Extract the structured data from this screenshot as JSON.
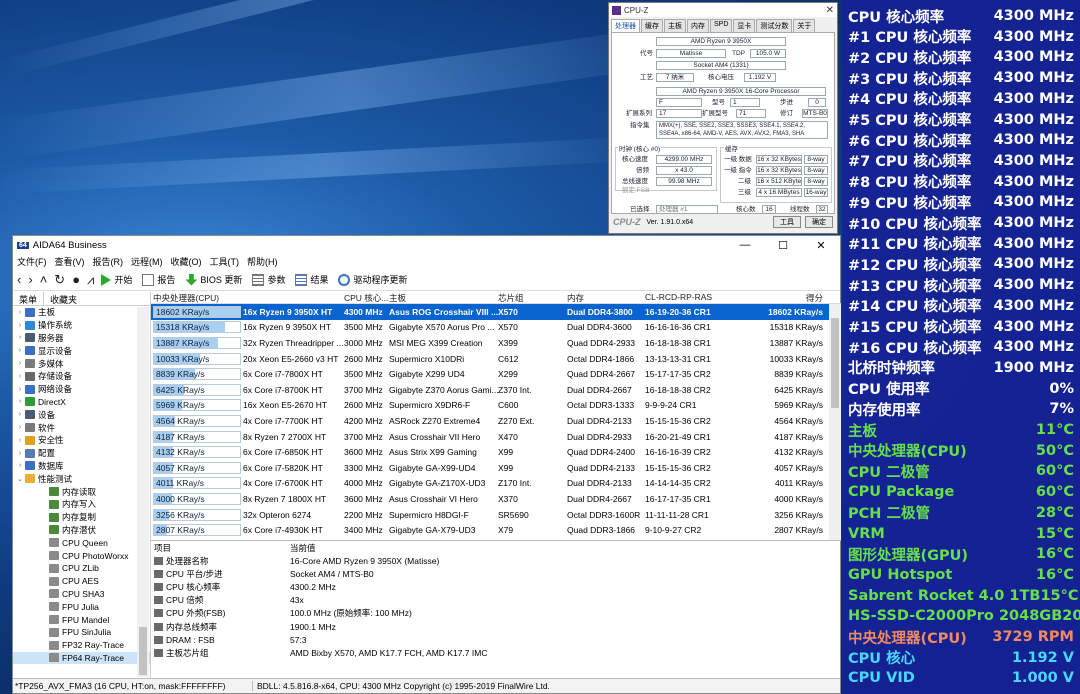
{
  "cpuz": {
    "title": "CPU-Z",
    "tabs": [
      "处理器",
      "缓存",
      "主板",
      "内存",
      "SPD",
      "显卡",
      "测试分数",
      "关于"
    ],
    "name": "AMD Ryzen 9 3950X",
    "codename_label": "代号",
    "codename": "Matisse",
    "tdp_label": "TDP",
    "tdp": "105.0 W",
    "socket": "Socket AM4 (1331)",
    "process_label": "工艺",
    "process": "7 纳米",
    "voltage_label": "核心电压",
    "voltage": "1.192 V",
    "spec": "AMD Ryzen 9 3950X 16-Core Processor",
    "family": "F",
    "model_label": "型号",
    "model": "1",
    "stepping_label": "步进",
    "stepping": "0",
    "ext_family_label": "扩展系列",
    "ext_family": "17",
    "ext_model_label": "扩展型号",
    "ext_model": "71",
    "revision_label": "修订",
    "revision": "MTS-B0",
    "instructions_label": "指令集",
    "instructions": "MMX(+), SSE, SSE2, SSE3, SSSE3, SSE4.1, SSE4.2, SSE4A, x86-64, AMD-V, AES, AVX, AVX2, FMA3, SHA",
    "clocks_title": "时钟 (核心 #0)",
    "core_speed_label": "核心速度",
    "core_speed": "4299.00 MHz",
    "multiplier_label": "倍频",
    "multiplier": "x 43.0",
    "bus_speed_label": "总线速度",
    "bus_speed": "99.98 MHz",
    "rated_fsb_label": "额定 FSB",
    "cache_title": "缓存",
    "l1d_label": "一级 数据",
    "l1d": "16 x 32 KBytes",
    "l1d_way": "8-way",
    "l1i_label": "一级 指令",
    "l1i": "16 x 32 KBytes",
    "l1i_way": "8-way",
    "l2_label": "二级",
    "l2": "16 x 512 KBytes",
    "l2_way": "8-way",
    "l3_label": "三级",
    "l3": "4 x 16 MBytes",
    "l3_way": "16-way",
    "selection_label": "已选择",
    "selection": "处理器 #1",
    "cores_label": "核心数",
    "cores": "16",
    "threads_label": "线程数",
    "threads": "32",
    "brand": "CPU-Z",
    "version": "Ver. 1.91.0.x64",
    "tools_label": "工具",
    "ok_label": "确定"
  },
  "osd": {
    "colors": {
      "white": "#ffffff",
      "green": "#66e04a",
      "orange": "#f08a60",
      "cyan": "#48d8ff"
    },
    "rows": [
      {
        "label": "CPU 核心频率",
        "value": "4300 MHz",
        "color": "white"
      },
      {
        "label": "#1 CPU 核心频率",
        "value": "4300 MHz",
        "color": "white"
      },
      {
        "label": "#2 CPU 核心频率",
        "value": "4300 MHz",
        "color": "white"
      },
      {
        "label": "#3 CPU 核心频率",
        "value": "4300 MHz",
        "color": "white"
      },
      {
        "label": "#4 CPU 核心频率",
        "value": "4300 MHz",
        "color": "white"
      },
      {
        "label": "#5 CPU 核心频率",
        "value": "4300 MHz",
        "color": "white"
      },
      {
        "label": "#6 CPU 核心频率",
        "value": "4300 MHz",
        "color": "white"
      },
      {
        "label": "#7 CPU 核心频率",
        "value": "4300 MHz",
        "color": "white"
      },
      {
        "label": "#8 CPU 核心频率",
        "value": "4300 MHz",
        "color": "white"
      },
      {
        "label": "#9 CPU 核心频率",
        "value": "4300 MHz",
        "color": "white"
      },
      {
        "label": "#10 CPU 核心频率",
        "value": "4300 MHz",
        "color": "white"
      },
      {
        "label": "#11 CPU 核心频率",
        "value": "4300 MHz",
        "color": "white"
      },
      {
        "label": "#12 CPU 核心频率",
        "value": "4300 MHz",
        "color": "white"
      },
      {
        "label": "#13 CPU 核心频率",
        "value": "4300 MHz",
        "color": "white"
      },
      {
        "label": "#14 CPU 核心频率",
        "value": "4300 MHz",
        "color": "white"
      },
      {
        "label": "#15 CPU 核心频率",
        "value": "4300 MHz",
        "color": "white"
      },
      {
        "label": "#16 CPU 核心频率",
        "value": "4300 MHz",
        "color": "white"
      },
      {
        "label": "北桥时钟频率",
        "value": "1900 MHz",
        "color": "white"
      },
      {
        "label": "CPU 使用率",
        "value": "0%",
        "color": "white"
      },
      {
        "label": "内存使用率",
        "value": "7%",
        "color": "white"
      },
      {
        "label": "主板",
        "value": "11°C",
        "color": "green"
      },
      {
        "label": "中央处理器(CPU)",
        "value": "50°C",
        "color": "green"
      },
      {
        "label": "CPU 二极管",
        "value": "60°C",
        "color": "green"
      },
      {
        "label": "CPU Package",
        "value": "60°C",
        "color": "green"
      },
      {
        "label": "PCH 二极管",
        "value": "28°C",
        "color": "green"
      },
      {
        "label": "VRM",
        "value": "15°C",
        "color": "green"
      },
      {
        "label": "图形处理器(GPU)",
        "value": "16°C",
        "color": "green"
      },
      {
        "label": "GPU Hotspot",
        "value": "16°C",
        "color": "green"
      },
      {
        "label": "Sabrent Rocket 4.0 1TB",
        "value": "15°C",
        "color": "green"
      },
      {
        "label": "HS-SSD-C2000Pro 2048GB",
        "value": "20°C",
        "color": "green"
      },
      {
        "label": "中央处理器(CPU)",
        "value": "3729 RPM",
        "color": "orange"
      },
      {
        "label": "CPU 核心",
        "value": "1.192 V",
        "color": "cyan"
      },
      {
        "label": "CPU VID",
        "value": "1.000 V",
        "color": "cyan"
      }
    ]
  },
  "aida": {
    "title": "AIDA64 Business",
    "logo": "64",
    "menu": [
      "文件(F)",
      "查看(V)",
      "报告(R)",
      "远程(M)",
      "收藏(O)",
      "工具(T)",
      "帮助(H)"
    ],
    "toolbar": {
      "start": "开始",
      "report": "报告",
      "bios": "BIOS 更新",
      "params": "参数",
      "results": "结果",
      "driver": "驱动程序更新"
    },
    "left_tabs": [
      "菜单",
      "收藏夹"
    ],
    "tree": [
      {
        "label": "主板",
        "level": 1,
        "expander": "›",
        "color": "#3a6fc4"
      },
      {
        "label": "操作系统",
        "level": 1,
        "expander": "›",
        "color": "#2a8ad4"
      },
      {
        "label": "服务器",
        "level": 1,
        "expander": "›",
        "color": "#4a5a70"
      },
      {
        "label": "显示设备",
        "level": 1,
        "expander": "›",
        "color": "#3a6fc4"
      },
      {
        "label": "多媒体",
        "level": 1,
        "expander": "›",
        "color": "#7a7a7a"
      },
      {
        "label": "存储设备",
        "level": 1,
        "expander": "›",
        "color": "#6a6a6a"
      },
      {
        "label": "网络设备",
        "level": 1,
        "expander": "›",
        "color": "#3a6fc4"
      },
      {
        "label": "DirectX",
        "level": 1,
        "expander": "›",
        "color": "#2e9a3a"
      },
      {
        "label": "设备",
        "level": 1,
        "expander": "›",
        "color": "#4a5a70"
      },
      {
        "label": "软件",
        "level": 1,
        "expander": "›",
        "color": "#7a7a7a"
      },
      {
        "label": "安全性",
        "level": 1,
        "expander": "›",
        "color": "#e0a020"
      },
      {
        "label": "配置",
        "level": 1,
        "expander": "›",
        "color": "#5a7ab0"
      },
      {
        "label": "数据库",
        "level": 1,
        "expander": "›",
        "color": "#3a6fc4"
      },
      {
        "label": "性能测试",
        "level": 1,
        "expander": "⌄",
        "color": "#e8b030"
      },
      {
        "label": "内存读取",
        "level": 2,
        "expander": "",
        "color": "#4a8a3a"
      },
      {
        "label": "内存写入",
        "level": 2,
        "expander": "",
        "color": "#4a8a3a"
      },
      {
        "label": "内存复制",
        "level": 2,
        "expander": "",
        "color": "#4a8a3a"
      },
      {
        "label": "内存潜伏",
        "level": 2,
        "expander": "",
        "color": "#4a8a3a"
      },
      {
        "label": "CPU Queen",
        "level": 2,
        "expander": "",
        "color": "#8a8a8a"
      },
      {
        "label": "CPU PhotoWorxx",
        "level": 2,
        "expander": "",
        "color": "#8a8a8a"
      },
      {
        "label": "CPU ZLib",
        "level": 2,
        "expander": "",
        "color": "#8a8a8a"
      },
      {
        "label": "CPU AES",
        "level": 2,
        "expander": "",
        "color": "#8a8a8a"
      },
      {
        "label": "CPU SHA3",
        "level": 2,
        "expander": "",
        "color": "#8a8a8a"
      },
      {
        "label": "FPU Julia",
        "level": 2,
        "expander": "",
        "color": "#8a8a8a"
      },
      {
        "label": "FPU Mandel",
        "level": 2,
        "expander": "",
        "color": "#8a8a8a"
      },
      {
        "label": "FPU SinJulia",
        "level": 2,
        "expander": "",
        "color": "#8a8a8a"
      },
      {
        "label": "FP32 Ray-Trace",
        "level": 2,
        "expander": "",
        "color": "#8a8a8a"
      },
      {
        "label": "FP64 Ray-Trace",
        "level": 2,
        "expander": "",
        "color": "#8a8a8a",
        "selected": true
      }
    ],
    "table": {
      "headers": [
        "中央处理器(CPU)",
        "CPU 核心...",
        "主板",
        "芯片组",
        "内存",
        "CL-RCD-RP-RAS",
        "得分"
      ],
      "rows": [
        {
          "score": 18602,
          "cpu": "16x Ryzen 9 3950X HT",
          "clock": "4300 MHz",
          "board": "Asus ROG Crosshair VIII ...",
          "chipset": "X570",
          "memory": "Dual DDR4-3800",
          "timing": "16-19-20-36 CR1",
          "score_text": "18602 KRay/s",
          "selected": true
        },
        {
          "score": 15318,
          "cpu": "16x Ryzen 9 3950X HT",
          "clock": "3500 MHz",
          "board": "Gigabyte X570 Aorus Pro ...",
          "chipset": "X570",
          "memory": "Dual DDR4-3600",
          "timing": "16-16-16-36 CR1",
          "score_text": "15318 KRay/s"
        },
        {
          "score": 13887,
          "cpu": "32x Ryzen Threadripper ...",
          "clock": "3000 MHz",
          "board": "MSI MEG X399 Creation",
          "chipset": "X399",
          "memory": "Quad DDR4-2933",
          "timing": "16-18-18-38 CR1",
          "score_text": "13887 KRay/s"
        },
        {
          "score": 10033,
          "cpu": "20x Xeon E5-2660 v3 HT",
          "clock": "2600 MHz",
          "board": "Supermicro X10DRi",
          "chipset": "C612",
          "memory": "Octal DDR4-1866",
          "timing": "13-13-13-31 CR1",
          "score_text": "10033 KRay/s"
        },
        {
          "score": 8839,
          "cpu": "6x Core i7-7800X HT",
          "clock": "3500 MHz",
          "board": "Gigabyte X299 UD4",
          "chipset": "X299",
          "memory": "Quad DDR4-2667",
          "timing": "15-17-17-35 CR2",
          "score_text": "8839 KRay/s"
        },
        {
          "score": 6425,
          "cpu": "6x Core i7-8700K HT",
          "clock": "3700 MHz",
          "board": "Gigabyte Z370 Aorus Gami...",
          "chipset": "Z370 Int.",
          "memory": "Dual DDR4-2667",
          "timing": "16-18-18-38 CR2",
          "score_text": "6425 KRay/s"
        },
        {
          "score": 5969,
          "cpu": "16x Xeon E5-2670 HT",
          "clock": "2600 MHz",
          "board": "Supermicro X9DR6-F",
          "chipset": "C600",
          "memory": "Octal DDR3-1333",
          "timing": "9-9-9-24 CR1",
          "score_text": "5969 KRay/s"
        },
        {
          "score": 4564,
          "cpu": "4x Core i7-7700K HT",
          "clock": "4200 MHz",
          "board": "ASRock Z270 Extreme4",
          "chipset": "Z270 Ext.",
          "memory": "Dual DDR4-2133",
          "timing": "15-15-15-36 CR2",
          "score_text": "4564 KRay/s"
        },
        {
          "score": 4187,
          "cpu": "8x Ryzen 7 2700X HT",
          "clock": "3700 MHz",
          "board": "Asus Crosshair VII Hero",
          "chipset": "X470",
          "memory": "Dual DDR4-2933",
          "timing": "16-20-21-49 CR1",
          "score_text": "4187 KRay/s"
        },
        {
          "score": 4132,
          "cpu": "6x Core i7-6850K HT",
          "clock": "3600 MHz",
          "board": "Asus Strix X99 Gaming",
          "chipset": "X99",
          "memory": "Quad DDR4-2400",
          "timing": "16-16-16-39 CR2",
          "score_text": "4132 KRay/s"
        },
        {
          "score": 4057,
          "cpu": "6x Core i7-5820K HT",
          "clock": "3300 MHz",
          "board": "Gigabyte GA-X99-UD4",
          "chipset": "X99",
          "memory": "Quad DDR4-2133",
          "timing": "15-15-15-36 CR2",
          "score_text": "4057 KRay/s"
        },
        {
          "score": 4011,
          "cpu": "4x Core i7-6700K HT",
          "clock": "4000 MHz",
          "board": "Gigabyte GA-Z170X-UD3",
          "chipset": "Z170 Int.",
          "memory": "Dual DDR4-2133",
          "timing": "14-14-14-35 CR2",
          "score_text": "4011 KRay/s"
        },
        {
          "score": 4000,
          "cpu": "8x Ryzen 7 1800X HT",
          "clock": "3600 MHz",
          "board": "Asus Crosshair VI Hero",
          "chipset": "X370",
          "memory": "Dual DDR4-2667",
          "timing": "16-17-17-35 CR1",
          "score_text": "4000 KRay/s"
        },
        {
          "score": 3256,
          "cpu": "32x Opteron 6274",
          "clock": "2200 MHz",
          "board": "Supermicro H8DGI-F",
          "chipset": "SR5690",
          "memory": "Octal DDR3-1600R",
          "timing": "11-11-11-28 CR1",
          "score_text": "3256 KRay/s"
        },
        {
          "score": 2807,
          "cpu": "6x Core i7-4930K HT",
          "clock": "3400 MHz",
          "board": "Gigabyte GA-X79-UD3",
          "chipset": "X79",
          "memory": "Quad DDR3-1866",
          "timing": "9-10-9-27 CR2",
          "score_text": "2807 KRay/s"
        }
      ]
    },
    "detail": {
      "headers": [
        "项目",
        "当前值"
      ],
      "rows": [
        {
          "key": "处理器名称",
          "value": "16-Core AMD Ryzen 9 3950X  (Matisse)"
        },
        {
          "key": "CPU 平台/步进",
          "value": "Socket AM4 / MTS-B0"
        },
        {
          "key": "CPU 核心频率",
          "value": "4300.2 MHz"
        },
        {
          "key": "CPU 倍频",
          "value": "43x"
        },
        {
          "key": "CPU 外频(FSB)",
          "value": "100.0 MHz  (原始频率:  100 MHz)"
        },
        {
          "key": "内存总线频率",
          "value": "1900.1 MHz"
        },
        {
          "key": "DRAM : FSB",
          "value": "57:3"
        },
        {
          "key": "主板芯片组",
          "value": "AMD Bixby X570, AMD K17.7 FCH, AMD K17.7 IMC"
        }
      ]
    },
    "status": {
      "left": "*TP256_AVX_FMA3  (16 CPU, HT:on, mask:FFFFFFFF)",
      "right": "BDLL: 4.5.816.8-x64, CPU: 4300 MHz    Copyright (c) 1995-2019 FinalWire Ltd."
    }
  }
}
